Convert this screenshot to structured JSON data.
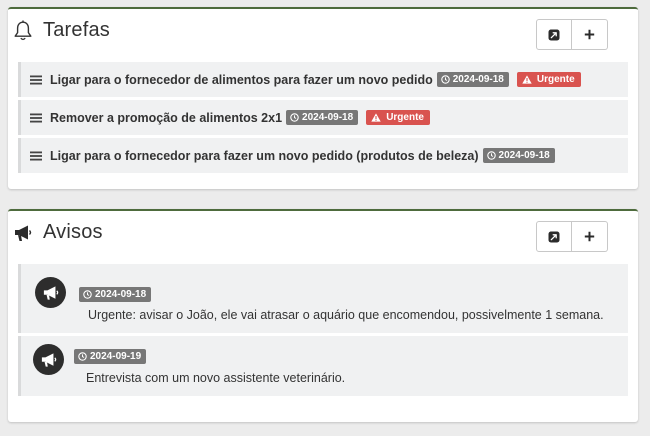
{
  "tasks_panel": {
    "title": "Tarefas",
    "icon": "bell-icon",
    "buttons": [
      {
        "name": "expand-button",
        "icon": "external-link-icon"
      },
      {
        "name": "add-button",
        "icon": "plus-icon"
      }
    ],
    "items": [
      {
        "text": "Ligar para o fornecedor de alimentos para fazer um novo pedido",
        "date": "2024-09-18",
        "urgent": "Urgente"
      },
      {
        "text": "Remover a promoção de alimentos 2x1",
        "date": "2024-09-18",
        "urgent": "Urgente"
      },
      {
        "text": "Ligar para o fornecedor para fazer um novo pedido (produtos de beleza)",
        "date": "2024-09-18"
      }
    ]
  },
  "notices_panel": {
    "title": "Avisos",
    "icon": "megaphone-icon",
    "buttons": [
      {
        "name": "expand-button",
        "icon": "external-link-icon"
      },
      {
        "name": "add-button",
        "icon": "plus-icon"
      }
    ],
    "items": [
      {
        "date": "2024-09-18",
        "text": "Urgente: avisar o João, ele vai atrasar o aquário que encomendou, possivelmente 1 semana."
      },
      {
        "date": "2024-09-19",
        "text": "Entrevista com um novo assistente veterinário."
      }
    ]
  },
  "colors": {
    "panel_accent": "#4e6b3d",
    "date_badge": "#777777",
    "urgent_badge": "#d9534f",
    "item_background": "#f0f1f2"
  }
}
